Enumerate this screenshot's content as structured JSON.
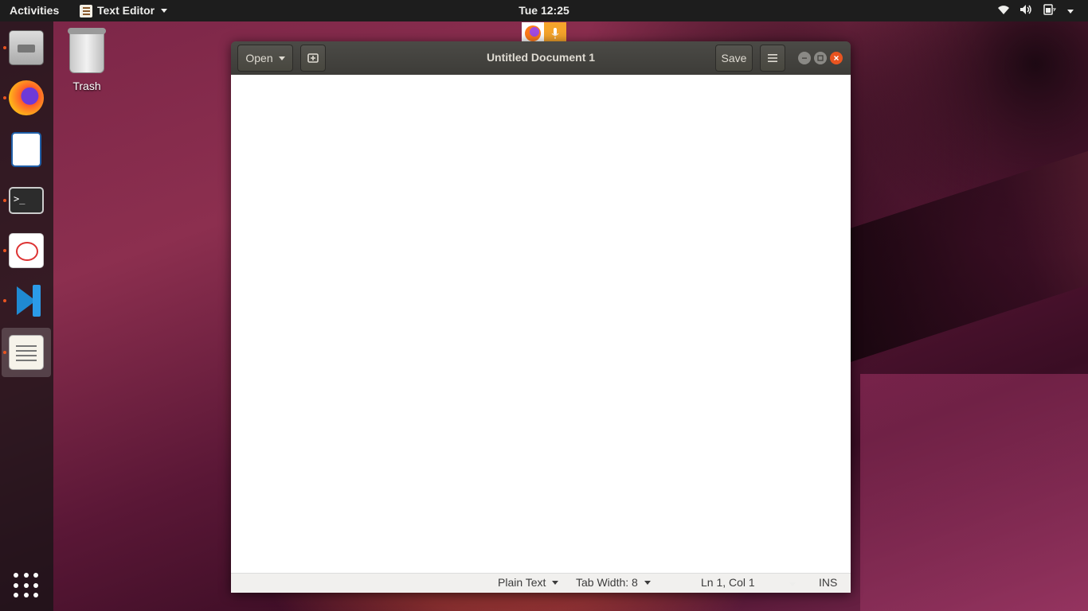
{
  "topbar": {
    "activities": "Activities",
    "app_name": "Text Editor",
    "clock": "Tue 12:25",
    "tray_icons": [
      "wifi-icon",
      "volume-icon",
      "battery-icon"
    ]
  },
  "indicators": [
    "firefox-icon",
    "microphone-icon"
  ],
  "dock": {
    "items": [
      {
        "name": "files-icon",
        "running": true
      },
      {
        "name": "firefox-icon",
        "running": true
      },
      {
        "name": "libreoffice-writer-icon",
        "running": false
      },
      {
        "name": "terminal-icon",
        "running": true
      },
      {
        "name": "document-viewer-icon",
        "running": true
      },
      {
        "name": "vscode-icon",
        "running": true
      },
      {
        "name": "text-editor-icon",
        "running": true,
        "active": true
      }
    ],
    "show_apps_icon": "app-grid-icon"
  },
  "desktop": {
    "trash_label": "Trash"
  },
  "editor": {
    "open_label": "Open",
    "save_label": "Save",
    "title": "Untitled Document 1",
    "content": "",
    "status": {
      "language": "Plain Text",
      "tab_width": "Tab Width: 8",
      "position": "Ln 1, Col 1",
      "mode": "INS"
    }
  },
  "colors": {
    "accent": "#e95420",
    "headerbar": "#3d3c38",
    "topbar": "#1d1d1d"
  }
}
